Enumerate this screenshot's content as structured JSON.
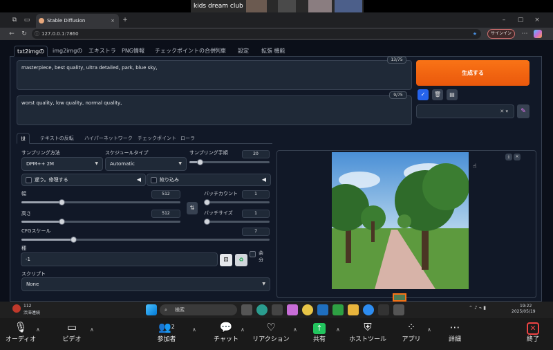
{
  "zoom": {
    "participant_name": "kids dream club",
    "controls": [
      {
        "label": "オーディオ",
        "icon": "microphone-icon"
      },
      {
        "label": "ビデオ",
        "icon": "video-camera-icon"
      },
      {
        "label": "参加者",
        "icon": "participants-icon",
        "count": "2"
      },
      {
        "label": "チャット",
        "icon": "chat-icon"
      },
      {
        "label": "リアクション",
        "icon": "heart-icon"
      },
      {
        "label": "共有",
        "icon": "share-screen-icon"
      },
      {
        "label": "ホストツール",
        "icon": "shield-icon"
      },
      {
        "label": "アプリ",
        "icon": "apps-icon"
      },
      {
        "label": "詳細",
        "icon": "more-icon"
      },
      {
        "label": "終了",
        "icon": "end-x-icon"
      }
    ]
  },
  "browser": {
    "tab_title": "Stable Diffusion",
    "url": "127.0.0.1:7860",
    "signin_label": "サインイン"
  },
  "webui": {
    "main_tabs": [
      "txt2imgの",
      "img2imgの",
      "エキストラ",
      "PNG情報",
      "チェックポイントの合併",
      "列車",
      "設定",
      "拡張 機能"
    ],
    "active_tab": "txt2imgの",
    "prompt": {
      "text": "masterpiece, best quality, ultra detailed, park, blue sky,",
      "counter": "13/75"
    },
    "negative_prompt": {
      "text": "worst quality, low quality, normal quality,",
      "counter": "9/75"
    },
    "generate_label": "生成する",
    "sub_tabs": [
      "世",
      "テキストの反転",
      "ハイパーネットワーク",
      "チェックポイント",
      "ローラ"
    ],
    "active_sub_tab": "世",
    "sampling_method": {
      "label": "サンプリング方法",
      "value": "DPM++ 2M"
    },
    "schedule_type": {
      "label": "スケジュールタイプ",
      "value": "Automatic"
    },
    "sampling_steps": {
      "label": "サンプリング手順",
      "value": "20",
      "fraction": 0.13
    },
    "hires_fix_label": "遅う。修理する",
    "refiner_label": "絞り込み",
    "width": {
      "label": "幅",
      "value": "512",
      "fraction": 0.25
    },
    "height": {
      "label": "高さ",
      "value": "512",
      "fraction": 0.25
    },
    "batch_count": {
      "label": "バッチカウント",
      "value": "1",
      "fraction": 0.0
    },
    "batch_size": {
      "label": "バッチサイズ",
      "value": "1",
      "fraction": 0.0
    },
    "cfg_scale": {
      "label": "CFGスケール",
      "value": "7",
      "fraction": 0.21
    },
    "seed": {
      "label": "種",
      "value": "-1"
    },
    "extra_label": "余分",
    "script": {
      "label": "スクリプト",
      "value": "None"
    }
  },
  "taskbar": {
    "weather_temp": "112",
    "weather_text": "渋滞連続",
    "search_placeholder": "検索",
    "time": "19:22",
    "date": "2025/05/19"
  }
}
